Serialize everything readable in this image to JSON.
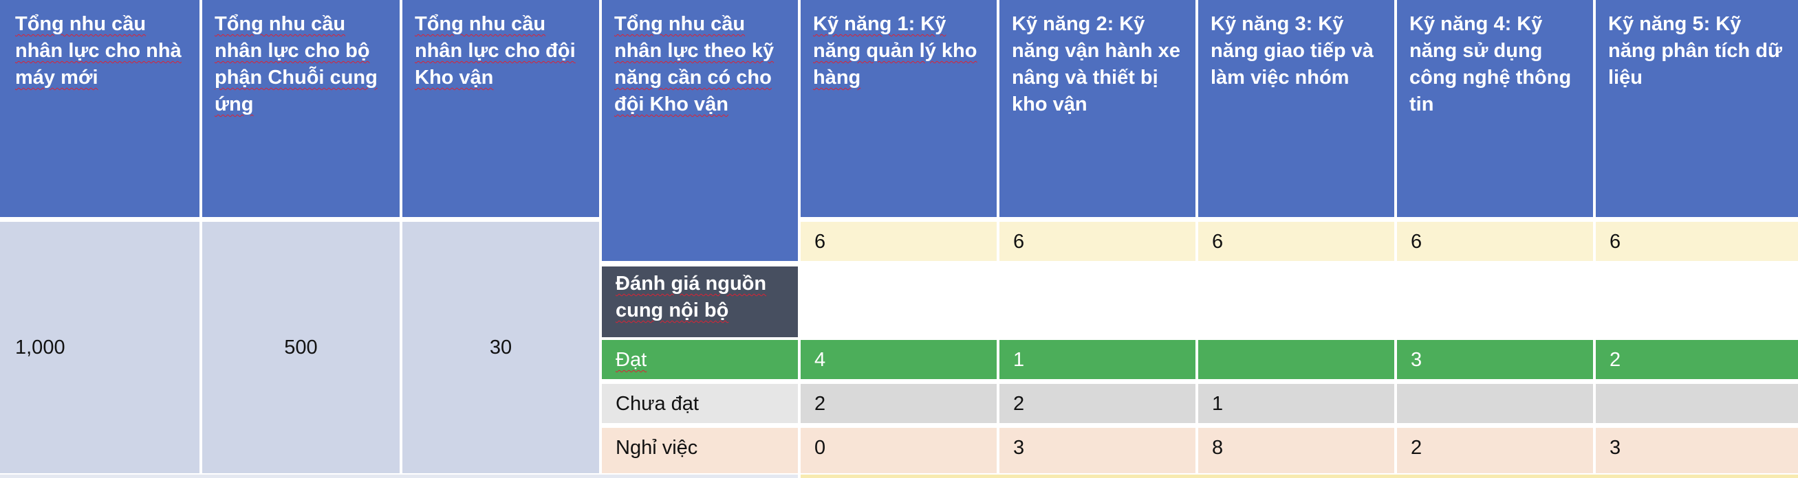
{
  "headers": [
    "Tổng nhu cầu nhân lực cho nhà máy mới",
    "Tổng nhu cầu nhân lực cho bộ phận Chuỗi cung ứng",
    "Tổng nhu cầu nhân lực cho đội Kho vận",
    "Tổng nhu cầu nhân lực theo kỹ năng cần có cho đội Kho vận",
    "Kỹ năng 1: Kỹ năng quản lý kho hàng",
    "Kỹ năng 2: Kỹ năng vận hành xe nâng và thiết bị kho vận",
    "Kỹ năng 3: Kỹ năng giao tiếp và làm việc nhóm",
    "Kỹ năng 4: Kỹ năng sử dụng công nghệ thông tin",
    "Kỹ năng 5: Kỹ năng phân tích dữ liệu"
  ],
  "totals": {
    "factory": "1,000",
    "supply_chain": "500",
    "logistics": "30"
  },
  "skill_demand": [
    "6",
    "6",
    "6",
    "6",
    "6"
  ],
  "assessment_title": "Đánh giá nguồn cung nội bộ",
  "rows": [
    {
      "label": "Đạt",
      "values": [
        "4",
        "1",
        "",
        "3",
        "2"
      ]
    },
    {
      "label": "Chưa đạt",
      "values": [
        "2",
        "2",
        "1",
        "",
        ""
      ]
    },
    {
      "label": "Nghỉ việc",
      "values": [
        "0",
        "3",
        "8",
        "2",
        "3"
      ]
    }
  ],
  "colors": {
    "header_blue": "#4f6fbf",
    "lavender": "#ced5e7",
    "cream": "#fbf3d2",
    "green": "#4cae5a",
    "gray": "#d9d9d9",
    "peach": "#f8e4d6",
    "slate": "#474f60"
  }
}
